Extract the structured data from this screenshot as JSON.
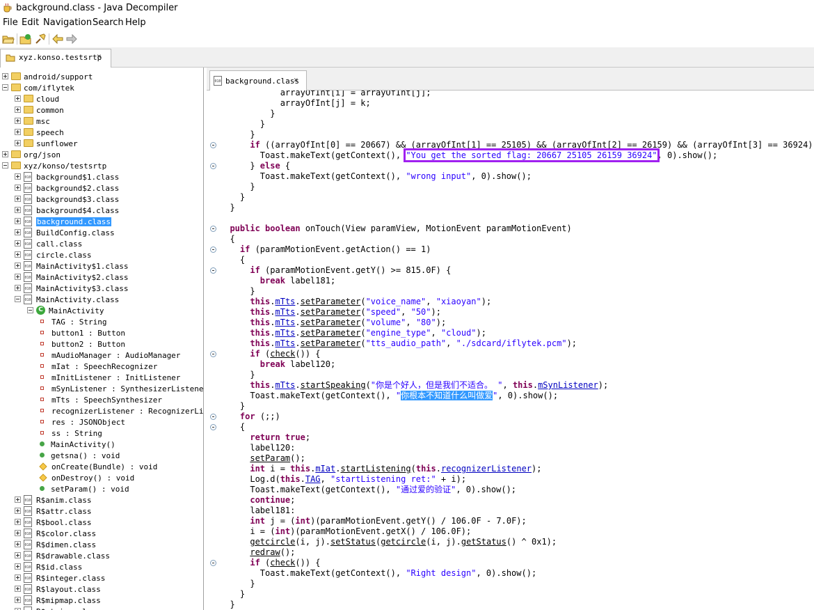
{
  "window": {
    "title": "background.class - Java Decompiler"
  },
  "menu": [
    "File",
    "Edit",
    "Navigation",
    "Search",
    "Help"
  ],
  "toolbar_icons": [
    "open-file-icon",
    "open-type-icon",
    "search-icon",
    "back-arrow-icon",
    "forward-arrow-icon"
  ],
  "left_tab": {
    "label": "xyz.konso.testsrtp",
    "close": "×"
  },
  "editor_tab": {
    "label": "background.class",
    "close": "×"
  },
  "tree": [
    {
      "label": "android/support",
      "kind": "package",
      "level": 0,
      "expander": "plus"
    },
    {
      "label": "com/iflytek",
      "kind": "package",
      "level": 0,
      "expander": "minus"
    },
    {
      "label": "cloud",
      "kind": "package",
      "level": 1,
      "expander": "plus"
    },
    {
      "label": "common",
      "kind": "package",
      "level": 1,
      "expander": "plus"
    },
    {
      "label": "msc",
      "kind": "package",
      "level": 1,
      "expander": "plus"
    },
    {
      "label": "speech",
      "kind": "package",
      "level": 1,
      "expander": "plus"
    },
    {
      "label": "sunflower",
      "kind": "package",
      "level": 1,
      "expander": "plus"
    },
    {
      "label": "org/json",
      "kind": "package",
      "level": 0,
      "expander": "plus"
    },
    {
      "label": "xyz/konso/testsrtp",
      "kind": "package",
      "level": 0,
      "expander": "minus"
    },
    {
      "label": "background$1.class",
      "kind": "class",
      "level": 1,
      "expander": "plus"
    },
    {
      "label": "background$2.class",
      "kind": "class",
      "level": 1,
      "expander": "plus"
    },
    {
      "label": "background$3.class",
      "kind": "class",
      "level": 1,
      "expander": "plus"
    },
    {
      "label": "background$4.class",
      "kind": "class",
      "level": 1,
      "expander": "plus"
    },
    {
      "label": "background.class",
      "kind": "class",
      "level": 1,
      "expander": "plus",
      "selected": true
    },
    {
      "label": "BuildConfig.class",
      "kind": "class",
      "level": 1,
      "expander": "plus"
    },
    {
      "label": "call.class",
      "kind": "class",
      "level": 1,
      "expander": "plus"
    },
    {
      "label": "circle.class",
      "kind": "class",
      "level": 1,
      "expander": "plus"
    },
    {
      "label": "MainActivity$1.class",
      "kind": "class",
      "level": 1,
      "expander": "plus"
    },
    {
      "label": "MainActivity$2.class",
      "kind": "class",
      "level": 1,
      "expander": "plus"
    },
    {
      "label": "MainActivity$3.class",
      "kind": "class",
      "level": 1,
      "expander": "plus"
    },
    {
      "label": "MainActivity.class",
      "kind": "class",
      "level": 1,
      "expander": "minus"
    },
    {
      "label": "MainActivity",
      "kind": "type",
      "level": 2,
      "expander": "minus"
    },
    {
      "label": "TAG : String",
      "kind": "field",
      "level": 3
    },
    {
      "label": "button1 : Button",
      "kind": "field",
      "level": 3
    },
    {
      "label": "button2 : Button",
      "kind": "field",
      "level": 3
    },
    {
      "label": "mAudioManager : AudioManager",
      "kind": "field",
      "level": 3
    },
    {
      "label": "mIat : SpeechRecognizer",
      "kind": "field",
      "level": 3
    },
    {
      "label": "mInitListener : InitListener",
      "kind": "field",
      "level": 3
    },
    {
      "label": "mSynListener : SynthesizerListener",
      "kind": "field",
      "level": 3
    },
    {
      "label": "mTts : SpeechSynthesizer",
      "kind": "field",
      "level": 3
    },
    {
      "label": "recognizerListener : RecognizerListener",
      "kind": "field",
      "level": 3
    },
    {
      "label": "res : JSONObject",
      "kind": "field",
      "level": 3
    },
    {
      "label": "ss : String",
      "kind": "field",
      "level": 3
    },
    {
      "label": "MainActivity()",
      "kind": "method",
      "level": 3
    },
    {
      "label": "getsna() : void",
      "kind": "method",
      "level": 3
    },
    {
      "label": "onCreate(Bundle) : void",
      "kind": "method-protected",
      "level": 3
    },
    {
      "label": "onDestroy() : void",
      "kind": "method-protected",
      "level": 3
    },
    {
      "label": "setParam() : void",
      "kind": "method",
      "level": 3
    },
    {
      "label": "R$anim.class",
      "kind": "class",
      "level": 1,
      "expander": "plus"
    },
    {
      "label": "R$attr.class",
      "kind": "class",
      "level": 1,
      "expander": "plus"
    },
    {
      "label": "R$bool.class",
      "kind": "class",
      "level": 1,
      "expander": "plus"
    },
    {
      "label": "R$color.class",
      "kind": "class",
      "level": 1,
      "expander": "plus"
    },
    {
      "label": "R$dimen.class",
      "kind": "class",
      "level": 1,
      "expander": "plus"
    },
    {
      "label": "R$drawable.class",
      "kind": "class",
      "level": 1,
      "expander": "plus"
    },
    {
      "label": "R$id.class",
      "kind": "class",
      "level": 1,
      "expander": "plus"
    },
    {
      "label": "R$integer.class",
      "kind": "class",
      "level": 1,
      "expander": "plus"
    },
    {
      "label": "R$layout.class",
      "kind": "class",
      "level": 1,
      "expander": "plus"
    },
    {
      "label": "R$mipmap.class",
      "kind": "class",
      "level": 1,
      "expander": "plus"
    },
    {
      "label": "R$string.class",
      "kind": "class",
      "level": 1,
      "expander": "plus"
    }
  ],
  "code_lines": [
    [
      {
        "t": "            arrayOfInt[i] = arrayOfInt[j];"
      }
    ],
    [
      {
        "t": "            arrayOfInt[j] = k;"
      }
    ],
    [
      {
        "t": "          }"
      }
    ],
    [
      {
        "t": "        }"
      }
    ],
    [
      {
        "t": "      }"
      }
    ],
    [
      {
        "t": "      "
      },
      {
        "t": "if",
        "c": "kw"
      },
      {
        "t": " ((arrayOfInt[0] == 20667) && (arrayOfInt[1] == 25105) && (arrayOfInt[2] == 26159) && (arrayOfInt[3] == 36924)) {"
      }
    ],
    [
      {
        "t": "        Toast.makeText(getContext(), "
      },
      {
        "t": "\"You get the sorted flag: 20667 25105 26159 36924\"",
        "c": "st hl"
      },
      {
        "t": ", 0).show();"
      }
    ],
    [
      {
        "t": "      } "
      },
      {
        "t": "else",
        "c": "kw"
      },
      {
        "t": " {"
      }
    ],
    [
      {
        "t": "        Toast.makeText(getContext(), "
      },
      {
        "t": "\"wrong input\"",
        "c": "st"
      },
      {
        "t": ", 0).show();"
      }
    ],
    [
      {
        "t": "      }"
      }
    ],
    [
      {
        "t": "    }"
      }
    ],
    [
      {
        "t": "  }"
      }
    ],
    [
      {
        "t": ""
      }
    ],
    [
      {
        "t": "  "
      },
      {
        "t": "public boolean",
        "c": "kw"
      },
      {
        "t": " onTouch(View paramView, MotionEvent paramMotionEvent)"
      }
    ],
    [
      {
        "t": "  {"
      }
    ],
    [
      {
        "t": "    "
      },
      {
        "t": "if",
        "c": "kw"
      },
      {
        "t": " (paramMotionEvent.getAction() == 1)"
      }
    ],
    [
      {
        "t": "    {"
      }
    ],
    [
      {
        "t": "      "
      },
      {
        "t": "if",
        "c": "kw"
      },
      {
        "t": " (paramMotionEvent.getY() >= 815.0F) {"
      }
    ],
    [
      {
        "t": "        "
      },
      {
        "t": "break",
        "c": "kw"
      },
      {
        "t": " label181;"
      }
    ],
    [
      {
        "t": "      }"
      }
    ],
    [
      {
        "t": "      "
      },
      {
        "t": "this",
        "c": "kw"
      },
      {
        "t": "."
      },
      {
        "t": "mTts",
        "c": "fl u"
      },
      {
        "t": "."
      },
      {
        "t": "setParameter",
        "c": "u"
      },
      {
        "t": "("
      },
      {
        "t": "\"voice_name\"",
        "c": "st"
      },
      {
        "t": ", "
      },
      {
        "t": "\"xiaoyan\"",
        "c": "st"
      },
      {
        "t": ");"
      }
    ],
    [
      {
        "t": "      "
      },
      {
        "t": "this",
        "c": "kw"
      },
      {
        "t": "."
      },
      {
        "t": "mTts",
        "c": "fl u"
      },
      {
        "t": "."
      },
      {
        "t": "setParameter",
        "c": "u"
      },
      {
        "t": "("
      },
      {
        "t": "\"speed\"",
        "c": "st"
      },
      {
        "t": ", "
      },
      {
        "t": "\"50\"",
        "c": "st"
      },
      {
        "t": ");"
      }
    ],
    [
      {
        "t": "      "
      },
      {
        "t": "this",
        "c": "kw"
      },
      {
        "t": "."
      },
      {
        "t": "mTts",
        "c": "fl u"
      },
      {
        "t": "."
      },
      {
        "t": "setParameter",
        "c": "u"
      },
      {
        "t": "("
      },
      {
        "t": "\"volume\"",
        "c": "st"
      },
      {
        "t": ", "
      },
      {
        "t": "\"80\"",
        "c": "st"
      },
      {
        "t": ");"
      }
    ],
    [
      {
        "t": "      "
      },
      {
        "t": "this",
        "c": "kw"
      },
      {
        "t": "."
      },
      {
        "t": "mTts",
        "c": "fl u"
      },
      {
        "t": "."
      },
      {
        "t": "setParameter",
        "c": "u"
      },
      {
        "t": "("
      },
      {
        "t": "\"engine_type\"",
        "c": "st"
      },
      {
        "t": ", "
      },
      {
        "t": "\"cloud\"",
        "c": "st"
      },
      {
        "t": ");"
      }
    ],
    [
      {
        "t": "      "
      },
      {
        "t": "this",
        "c": "kw"
      },
      {
        "t": "."
      },
      {
        "t": "mTts",
        "c": "fl u"
      },
      {
        "t": "."
      },
      {
        "t": "setParameter",
        "c": "u"
      },
      {
        "t": "("
      },
      {
        "t": "\"tts_audio_path\"",
        "c": "st"
      },
      {
        "t": ", "
      },
      {
        "t": "\"./sdcard/iflytek.pcm\"",
        "c": "st"
      },
      {
        "t": ");"
      }
    ],
    [
      {
        "t": "      "
      },
      {
        "t": "if",
        "c": "kw"
      },
      {
        "t": " ("
      },
      {
        "t": "check",
        "c": "u"
      },
      {
        "t": "()) {"
      }
    ],
    [
      {
        "t": "        "
      },
      {
        "t": "break",
        "c": "kw"
      },
      {
        "t": " label120;"
      }
    ],
    [
      {
        "t": "      }"
      }
    ],
    [
      {
        "t": "      "
      },
      {
        "t": "this",
        "c": "kw"
      },
      {
        "t": "."
      },
      {
        "t": "mTts",
        "c": "fl u"
      },
      {
        "t": "."
      },
      {
        "t": "startSpeaking",
        "c": "u"
      },
      {
        "t": "("
      },
      {
        "t": "\"你是个好人，但是我们不适合。 \"",
        "c": "st"
      },
      {
        "t": ", "
      },
      {
        "t": "this",
        "c": "kw"
      },
      {
        "t": "."
      },
      {
        "t": "mSynListener",
        "c": "fl u"
      },
      {
        "t": ");"
      }
    ],
    [
      {
        "t": "      Toast.makeText(getContext(), "
      },
      {
        "t": "\"",
        "c": "st"
      },
      {
        "t": "你根本不知道什么叫做爱",
        "c": "selcode"
      },
      {
        "t": "\"",
        "c": "st"
      },
      {
        "t": ", 0).show();"
      }
    ],
    [
      {
        "t": "    }"
      }
    ],
    [
      {
        "t": "    "
      },
      {
        "t": "for",
        "c": "kw"
      },
      {
        "t": " (;;)"
      }
    ],
    [
      {
        "t": "    {"
      }
    ],
    [
      {
        "t": "      "
      },
      {
        "t": "return true",
        "c": "kw"
      },
      {
        "t": ";"
      }
    ],
    [
      {
        "t": "      label120:"
      }
    ],
    [
      {
        "t": "      "
      },
      {
        "t": "setParam",
        "c": "u"
      },
      {
        "t": "();"
      }
    ],
    [
      {
        "t": "      "
      },
      {
        "t": "int",
        "c": "kw"
      },
      {
        "t": " i = "
      },
      {
        "t": "this",
        "c": "kw"
      },
      {
        "t": "."
      },
      {
        "t": "mIat",
        "c": "fl u"
      },
      {
        "t": "."
      },
      {
        "t": "startListening",
        "c": "u"
      },
      {
        "t": "("
      },
      {
        "t": "this",
        "c": "kw"
      },
      {
        "t": "."
      },
      {
        "t": "recognizerListener",
        "c": "fl u"
      },
      {
        "t": ");"
      }
    ],
    [
      {
        "t": "      Log.d("
      },
      {
        "t": "this",
        "c": "kw"
      },
      {
        "t": "."
      },
      {
        "t": "TAG",
        "c": "fl u"
      },
      {
        "t": ", "
      },
      {
        "t": "\"startListening ret:\"",
        "c": "st"
      },
      {
        "t": " + i);"
      }
    ],
    [
      {
        "t": "      Toast.makeText(getContext(), "
      },
      {
        "t": "\"通过爱的验证\"",
        "c": "st"
      },
      {
        "t": ", 0).show();"
      }
    ],
    [
      {
        "t": "      "
      },
      {
        "t": "continue",
        "c": "kw"
      },
      {
        "t": ";"
      }
    ],
    [
      {
        "t": "      label181:"
      }
    ],
    [
      {
        "t": "      "
      },
      {
        "t": "int",
        "c": "kw"
      },
      {
        "t": " j = ("
      },
      {
        "t": "int",
        "c": "kw"
      },
      {
        "t": ")(paramMotionEvent.getY() / 106.0F - 7.0F);"
      }
    ],
    [
      {
        "t": "      i = ("
      },
      {
        "t": "int",
        "c": "kw"
      },
      {
        "t": ")(paramMotionEvent.getX() / 106.0F);"
      }
    ],
    [
      {
        "t": "      "
      },
      {
        "t": "getcircle",
        "c": "u"
      },
      {
        "t": "(i, j)."
      },
      {
        "t": "setStatus",
        "c": "u"
      },
      {
        "t": "("
      },
      {
        "t": "getcircle",
        "c": "u"
      },
      {
        "t": "(i, j)."
      },
      {
        "t": "getStatus",
        "c": "u"
      },
      {
        "t": "() ^ 0x1);"
      }
    ],
    [
      {
        "t": "      "
      },
      {
        "t": "redraw",
        "c": "u"
      },
      {
        "t": "();"
      }
    ],
    [
      {
        "t": "      "
      },
      {
        "t": "if",
        "c": "kw"
      },
      {
        "t": " ("
      },
      {
        "t": "check",
        "c": "u"
      },
      {
        "t": "()) {"
      }
    ],
    [
      {
        "t": "        Toast.makeText(getContext(), "
      },
      {
        "t": "\"Right design\"",
        "c": "st"
      },
      {
        "t": ", 0).show();"
      }
    ],
    [
      {
        "t": "      }"
      }
    ],
    [
      {
        "t": "    }"
      }
    ],
    [
      {
        "t": "  }"
      }
    ]
  ]
}
